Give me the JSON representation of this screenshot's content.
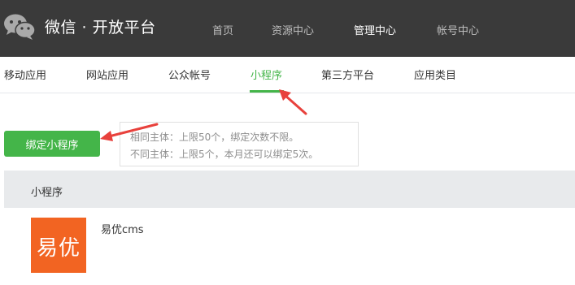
{
  "header": {
    "brand": "微信 · 开放平台",
    "nav": [
      {
        "label": "首页",
        "active": false
      },
      {
        "label": "资源中心",
        "active": false
      },
      {
        "label": "管理中心",
        "active": true
      },
      {
        "label": "帐号中心",
        "active": false
      }
    ],
    "logo_icon": "wechat-icon"
  },
  "tabs": [
    {
      "label": "移动应用",
      "active": false
    },
    {
      "label": "网站应用",
      "active": false
    },
    {
      "label": "公众帐号",
      "active": false
    },
    {
      "label": "小程序",
      "active": true
    },
    {
      "label": "第三方平台",
      "active": false
    },
    {
      "label": "应用类目",
      "active": false
    }
  ],
  "actions": {
    "bind_button_label": "绑定小程序"
  },
  "tips": {
    "line1": "相同主体：上限50个，绑定次数不限。",
    "line2": "不同主体：上限5个，本月还可以绑定5次。"
  },
  "table": {
    "header": "小程序",
    "rows": [
      {
        "logo_text": "易优",
        "name": "易优cms"
      }
    ]
  },
  "colors": {
    "accent_green": "#44b549",
    "header_bg": "#3a3a3a",
    "annotation_red": "#e8413c",
    "logo_orange": "#f26422"
  }
}
